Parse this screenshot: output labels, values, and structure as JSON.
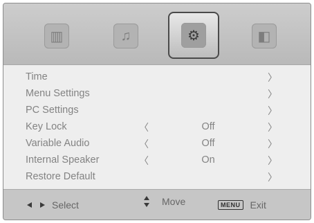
{
  "tabs": [
    {
      "icon": "picture-icon",
      "glyph": "▥"
    },
    {
      "icon": "sound-icon",
      "glyph": "♫"
    },
    {
      "icon": "setup-icon",
      "glyph": "⚙"
    },
    {
      "icon": "lock-icon",
      "glyph": "◧"
    }
  ],
  "active_tab_index": 2,
  "menu": {
    "items": [
      {
        "label": "Time",
        "left_arrow": "",
        "value": "",
        "right_arrow": "〉"
      },
      {
        "label": "Menu Settings",
        "left_arrow": "",
        "value": "",
        "right_arrow": "〉"
      },
      {
        "label": "PC Settings",
        "left_arrow": "",
        "value": "",
        "right_arrow": "〉"
      },
      {
        "label": "Key Lock",
        "left_arrow": "〈",
        "value": "Off",
        "right_arrow": "〉"
      },
      {
        "label": "Variable Audio",
        "left_arrow": "〈",
        "value": "Off",
        "right_arrow": "〉"
      },
      {
        "label": "Internal Speaker",
        "left_arrow": "〈",
        "value": "On",
        "right_arrow": "〉"
      },
      {
        "label": "Restore Default",
        "left_arrow": "",
        "value": "",
        "right_arrow": "〉"
      }
    ]
  },
  "footer": {
    "select_label": "Select",
    "move_label": "Move",
    "menu_key": "MENU",
    "exit_label": "Exit"
  },
  "colors": {
    "panel": "#c8c8c8",
    "menu_bg": "#eeeeee",
    "text": "#838383",
    "active_tab_border": "#4a4a4a"
  }
}
